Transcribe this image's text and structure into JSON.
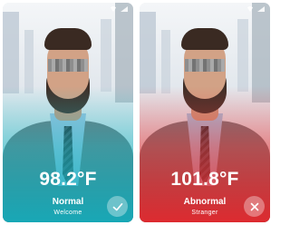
{
  "screens": [
    {
      "temperature": "98.2°F",
      "status": "Normal",
      "subtitle": "Welcome",
      "result_icon": "check-icon",
      "tint_color": "#1fb3c2"
    },
    {
      "temperature": "101.8°F",
      "status": "Abnormal",
      "subtitle": "Stranger",
      "result_icon": "close-icon",
      "tint_color": "#e8343a"
    }
  ],
  "status_icons": [
    "wifi-icon",
    "signal-icon"
  ]
}
